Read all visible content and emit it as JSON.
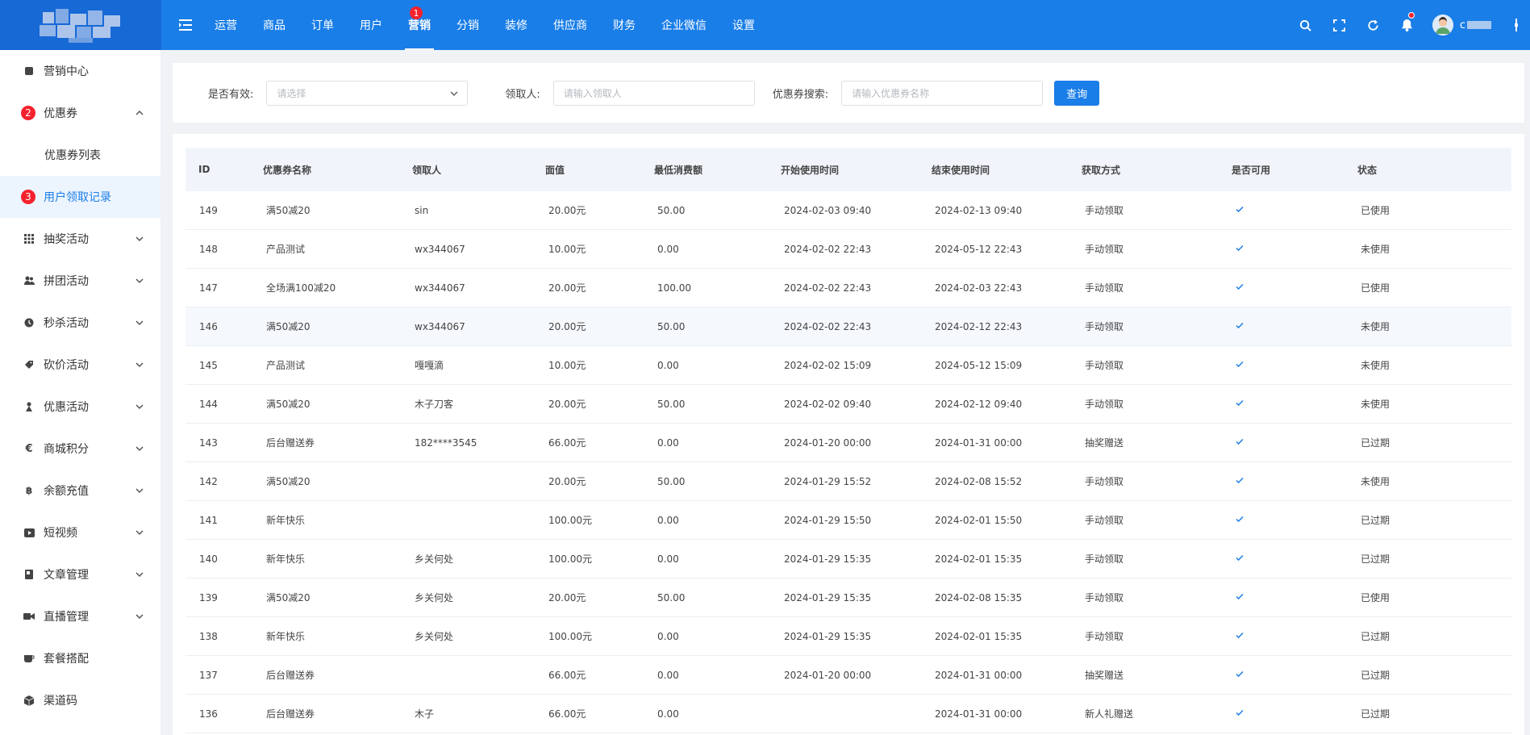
{
  "header": {
    "nav": [
      {
        "label": "运营"
      },
      {
        "label": "商品"
      },
      {
        "label": "订单"
      },
      {
        "label": "用户"
      },
      {
        "label": "营销",
        "active": true,
        "badge": "1"
      },
      {
        "label": "分销"
      },
      {
        "label": "装修"
      },
      {
        "label": "供应商"
      },
      {
        "label": "财务"
      },
      {
        "label": "企业微信"
      },
      {
        "label": "设置"
      }
    ],
    "username": "c",
    "icons": [
      "search-icon",
      "fullscreen-icon",
      "refresh-icon",
      "bell-icon"
    ]
  },
  "sidebar": {
    "items": [
      {
        "label": "营销中心",
        "icon": "marketing-icon"
      },
      {
        "label": "优惠券",
        "badge": "2",
        "expanded": true
      },
      {
        "label": "优惠券列表",
        "sub": true
      },
      {
        "label": "用户领取记录",
        "sub": true,
        "active": true,
        "badge": "3"
      },
      {
        "label": "抽奖活动",
        "icon": "grid-icon"
      },
      {
        "label": "拼团活动",
        "icon": "group-icon"
      },
      {
        "label": "秒杀活动",
        "icon": "flash-icon"
      },
      {
        "label": "砍价活动",
        "icon": "tag-icon"
      },
      {
        "label": "优惠活动",
        "icon": "gift-icon"
      },
      {
        "label": "商城积分",
        "icon": "euro-icon"
      },
      {
        "label": "余额充值",
        "icon": "bitcoin-icon"
      },
      {
        "label": "短视频",
        "icon": "video-icon"
      },
      {
        "label": "文章管理",
        "icon": "book-icon"
      },
      {
        "label": "直播管理",
        "icon": "camera-icon"
      },
      {
        "label": "套餐搭配",
        "icon": "cup-icon"
      },
      {
        "label": "渠道码",
        "icon": "cube-icon"
      }
    ]
  },
  "filters": {
    "valid_label": "是否有效:",
    "valid_placeholder": "请选择",
    "receiver_label": "领取人:",
    "receiver_placeholder": "请输入领取人",
    "coupon_label": "优惠券搜索:",
    "coupon_placeholder": "请输入优惠券名称",
    "query_button": "查询"
  },
  "table": {
    "headers": {
      "id": "ID",
      "name": "优惠券名称",
      "user": "领取人",
      "value": "面值",
      "min": "最低消费额",
      "start": "开始使用时间",
      "end": "结束使用时间",
      "method": "获取方式",
      "available": "是否可用",
      "status": "状态"
    },
    "rows": [
      {
        "id": "149",
        "name": "满50减20",
        "user": "sin",
        "value": "20.00元",
        "min": "50.00",
        "start": "2024-02-03 09:40",
        "end": "2024-02-13 09:40",
        "method": "手动领取",
        "status": "已使用"
      },
      {
        "id": "148",
        "name": "产品测试",
        "user": "wx344067",
        "value": "10.00元",
        "min": "0.00",
        "start": "2024-02-02 22:43",
        "end": "2024-05-12 22:43",
        "method": "手动领取",
        "status": "未使用"
      },
      {
        "id": "147",
        "name": "全场满100减20",
        "user": "wx344067",
        "value": "20.00元",
        "min": "100.00",
        "start": "2024-02-02 22:43",
        "end": "2024-02-03 22:43",
        "method": "手动领取",
        "status": "已使用"
      },
      {
        "id": "146",
        "name": "满50减20",
        "user": "wx344067",
        "value": "20.00元",
        "min": "50.00",
        "start": "2024-02-02 22:43",
        "end": "2024-02-12 22:43",
        "method": "手动领取",
        "status": "未使用",
        "hover": true
      },
      {
        "id": "145",
        "name": "产品测试",
        "user": "嘎嘎滴",
        "value": "10.00元",
        "min": "0.00",
        "start": "2024-02-02 15:09",
        "end": "2024-05-12 15:09",
        "method": "手动领取",
        "status": "未使用"
      },
      {
        "id": "144",
        "name": "满50减20",
        "user": "木子刀客",
        "value": "20.00元",
        "min": "50.00",
        "start": "2024-02-02 09:40",
        "end": "2024-02-12 09:40",
        "method": "手动领取",
        "status": "未使用"
      },
      {
        "id": "143",
        "name": "后台赠送券",
        "user": "182****3545",
        "value": "66.00元",
        "min": "0.00",
        "start": "2024-01-20 00:00",
        "end": "2024-01-31 00:00",
        "method": "抽奖赠送",
        "status": "已过期"
      },
      {
        "id": "142",
        "name": "满50减20",
        "user": "",
        "value": "20.00元",
        "min": "50.00",
        "start": "2024-01-29 15:52",
        "end": "2024-02-08 15:52",
        "method": "手动领取",
        "status": "未使用"
      },
      {
        "id": "141",
        "name": "新年快乐",
        "user": "",
        "value": "100.00元",
        "min": "0.00",
        "start": "2024-01-29 15:50",
        "end": "2024-02-01 15:50",
        "method": "手动领取",
        "status": "已过期"
      },
      {
        "id": "140",
        "name": "新年快乐",
        "user": "乡关何处",
        "value": "100.00元",
        "min": "0.00",
        "start": "2024-01-29 15:35",
        "end": "2024-02-01 15:35",
        "method": "手动领取",
        "status": "已过期"
      },
      {
        "id": "139",
        "name": "满50减20",
        "user": "乡关何处",
        "value": "20.00元",
        "min": "50.00",
        "start": "2024-01-29 15:35",
        "end": "2024-02-08 15:35",
        "method": "手动领取",
        "status": "已使用"
      },
      {
        "id": "138",
        "name": "新年快乐",
        "user": "乡关何处",
        "value": "100.00元",
        "min": "0.00",
        "start": "2024-01-29 15:35",
        "end": "2024-02-01 15:35",
        "method": "手动领取",
        "status": "已过期"
      },
      {
        "id": "137",
        "name": "后台赠送券",
        "user": "",
        "value": "66.00元",
        "min": "0.00",
        "start": "2024-01-20 00:00",
        "end": "2024-01-31 00:00",
        "method": "抽奖赠送",
        "status": "已过期"
      },
      {
        "id": "136",
        "name": "后台赠送券",
        "user": "木子",
        "value": "66.00元",
        "min": "0.00",
        "start": "",
        "end": "2024-01-31 00:00",
        "method": "新人礼赠送",
        "status": "已过期"
      }
    ]
  },
  "colors": {
    "primary": "#1a7ee8",
    "badge": "#f5222d",
    "active_bg": "#ecf4fe"
  }
}
